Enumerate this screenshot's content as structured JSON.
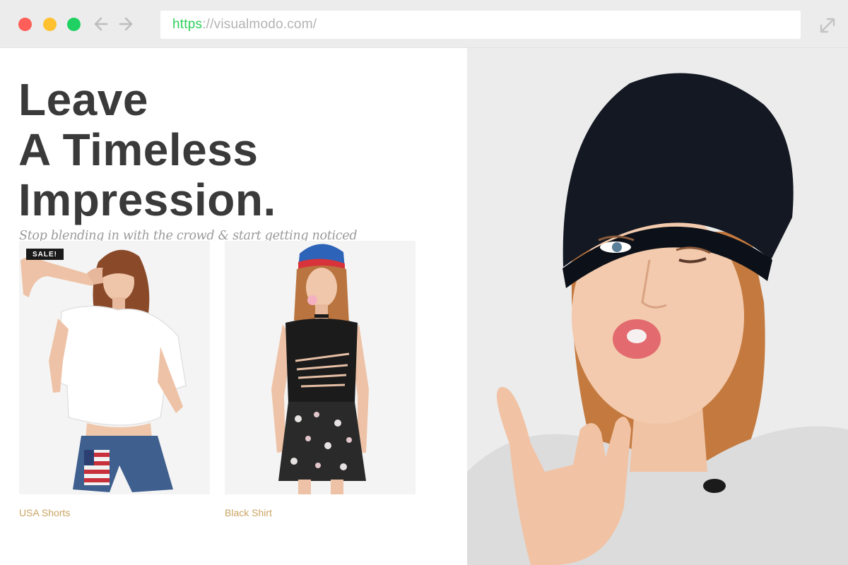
{
  "browser": {
    "url_scheme": "https",
    "url_rest": "://visualmodo.com/",
    "traffic_lights": {
      "close": "#ff5f58",
      "minimize": "#ffc12f",
      "zoom": "#1fd162"
    },
    "icons": [
      "back-arrow-icon",
      "forward-arrow-icon",
      "expand-icon"
    ]
  },
  "hero": {
    "headline_lines": [
      "Leave",
      "A Timeless",
      "Impression."
    ],
    "tagline": "Stop blending in with the crowd & start getting noticed"
  },
  "products": [
    {
      "name": "USA Shorts",
      "badge": "SALE!"
    },
    {
      "name": "Black Shirt"
    }
  ],
  "colors": {
    "headline": "#3a3a3a",
    "tagline": "#9a9a9a",
    "product_name": "#caa462",
    "url_scheme": "#2fcf5a"
  }
}
